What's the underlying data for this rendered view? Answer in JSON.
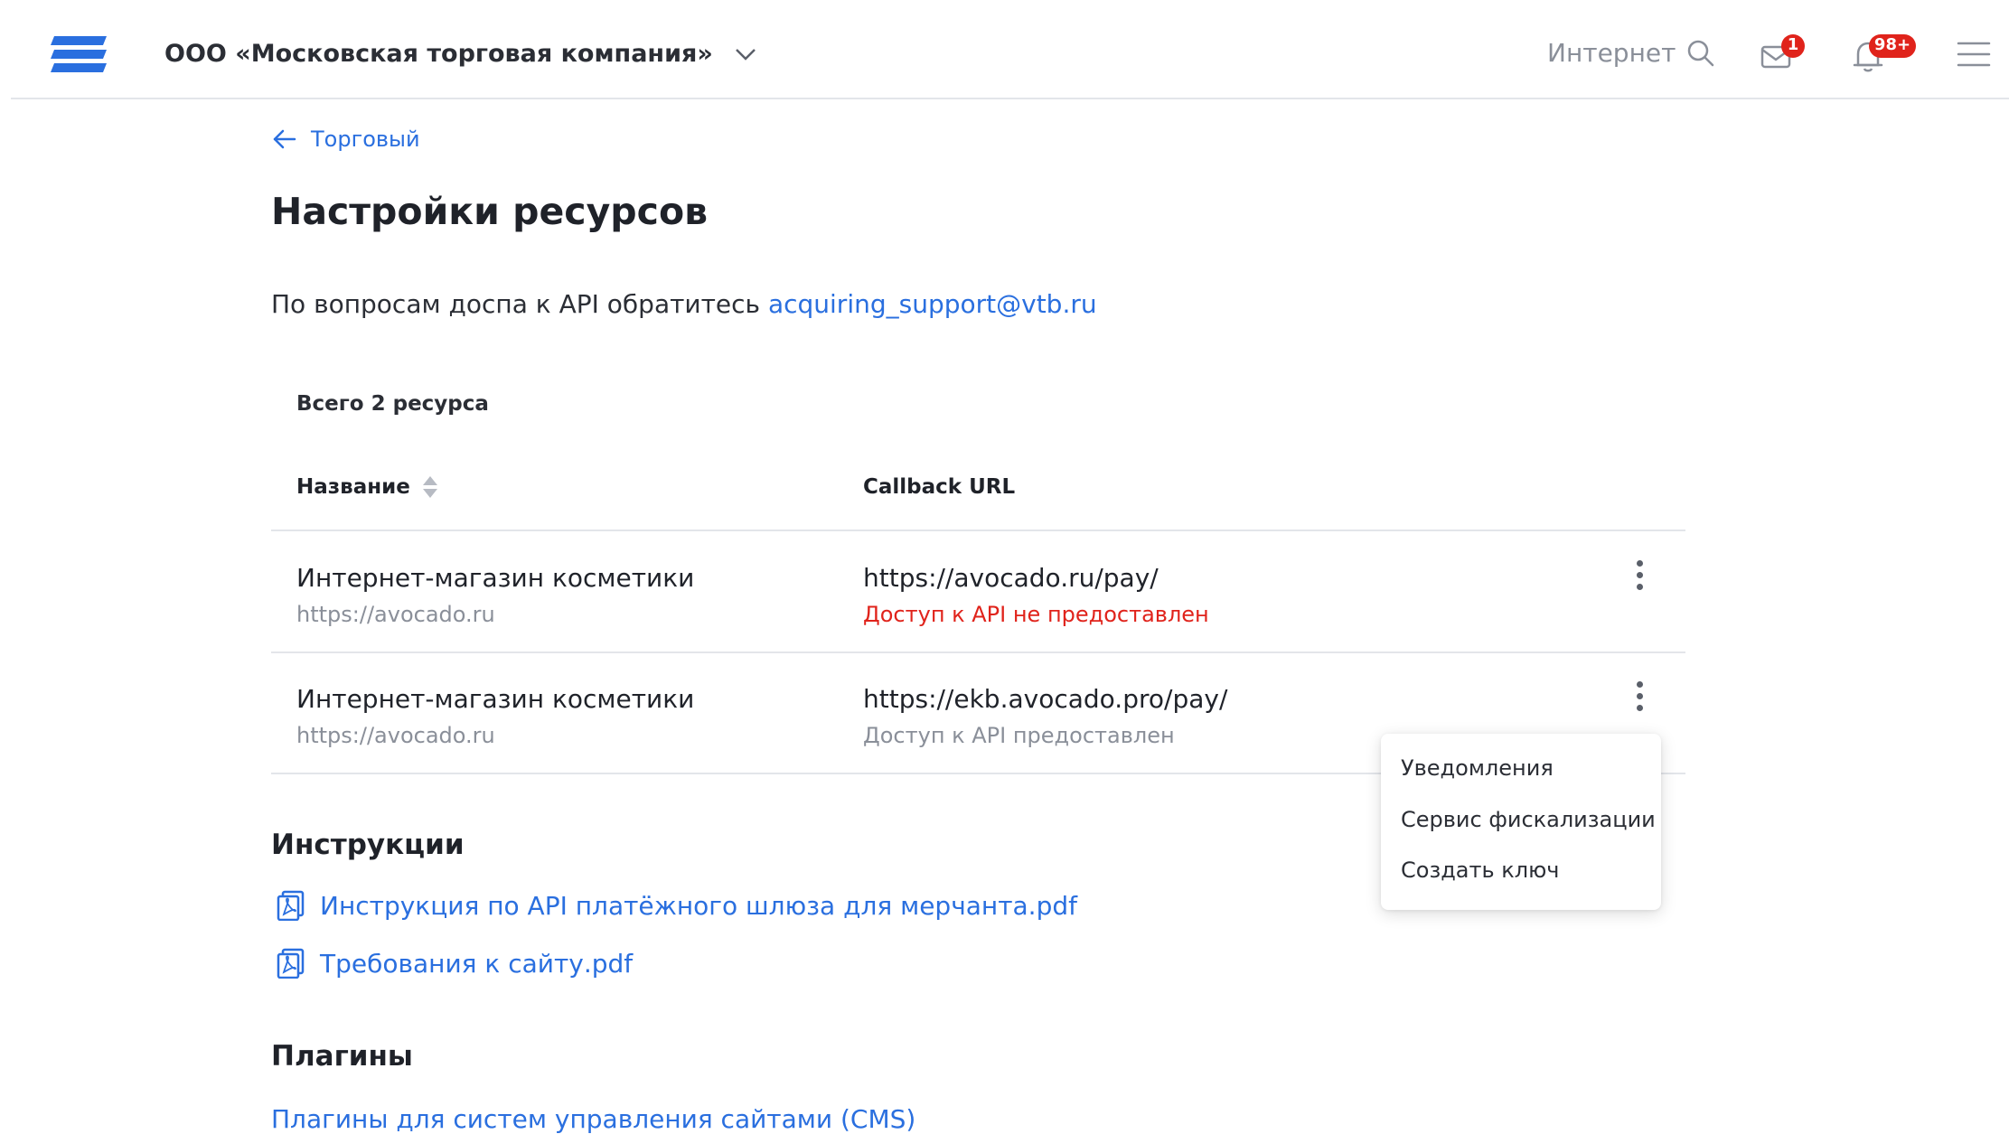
{
  "header": {
    "company_name": "ООО «Московская торговая компания»",
    "search_label": "Интернет",
    "mail_badge": "1",
    "bell_badge": "98+"
  },
  "breadcrumb": {
    "back_label": "Торговый"
  },
  "page": {
    "title": "Настройки ресурсов",
    "support_text": "По вопросам доспа к API обратитесь",
    "support_email": "acquiring_support@vtb.ru"
  },
  "table": {
    "total_label": "Всего 2 ресурса",
    "col_name": "Название",
    "col_url": "Callback URL",
    "rows": [
      {
        "name": "Интернет-магазин косметики",
        "site": "https://avocado.ru",
        "url": "https://avocado.ru/pay/",
        "status": "Доступ к API не предоставлен"
      },
      {
        "name": "Интернет-магазин косметики",
        "site": "https://avocado.ru",
        "url": "https://ekb.avocado.pro/pay/",
        "status": "Доступ к API предоставлен"
      }
    ]
  },
  "context_menu": {
    "items": [
      "Уведомления",
      "Сервис фискализации",
      "Создать ключ"
    ]
  },
  "instructions": {
    "title": "Инструкции",
    "docs": [
      "Инструкция по API платёжного шлюза для мерчанта.pdf",
      "Требования к сайту.pdf"
    ]
  },
  "plugins": {
    "title": "Плагины",
    "link": "Плагины для систем управления сайтами (CMS)"
  },
  "colors": {
    "accent": "#2a6fdf",
    "error": "#e0231b",
    "muted": "#8a8f99",
    "badge": "#e0231b"
  }
}
